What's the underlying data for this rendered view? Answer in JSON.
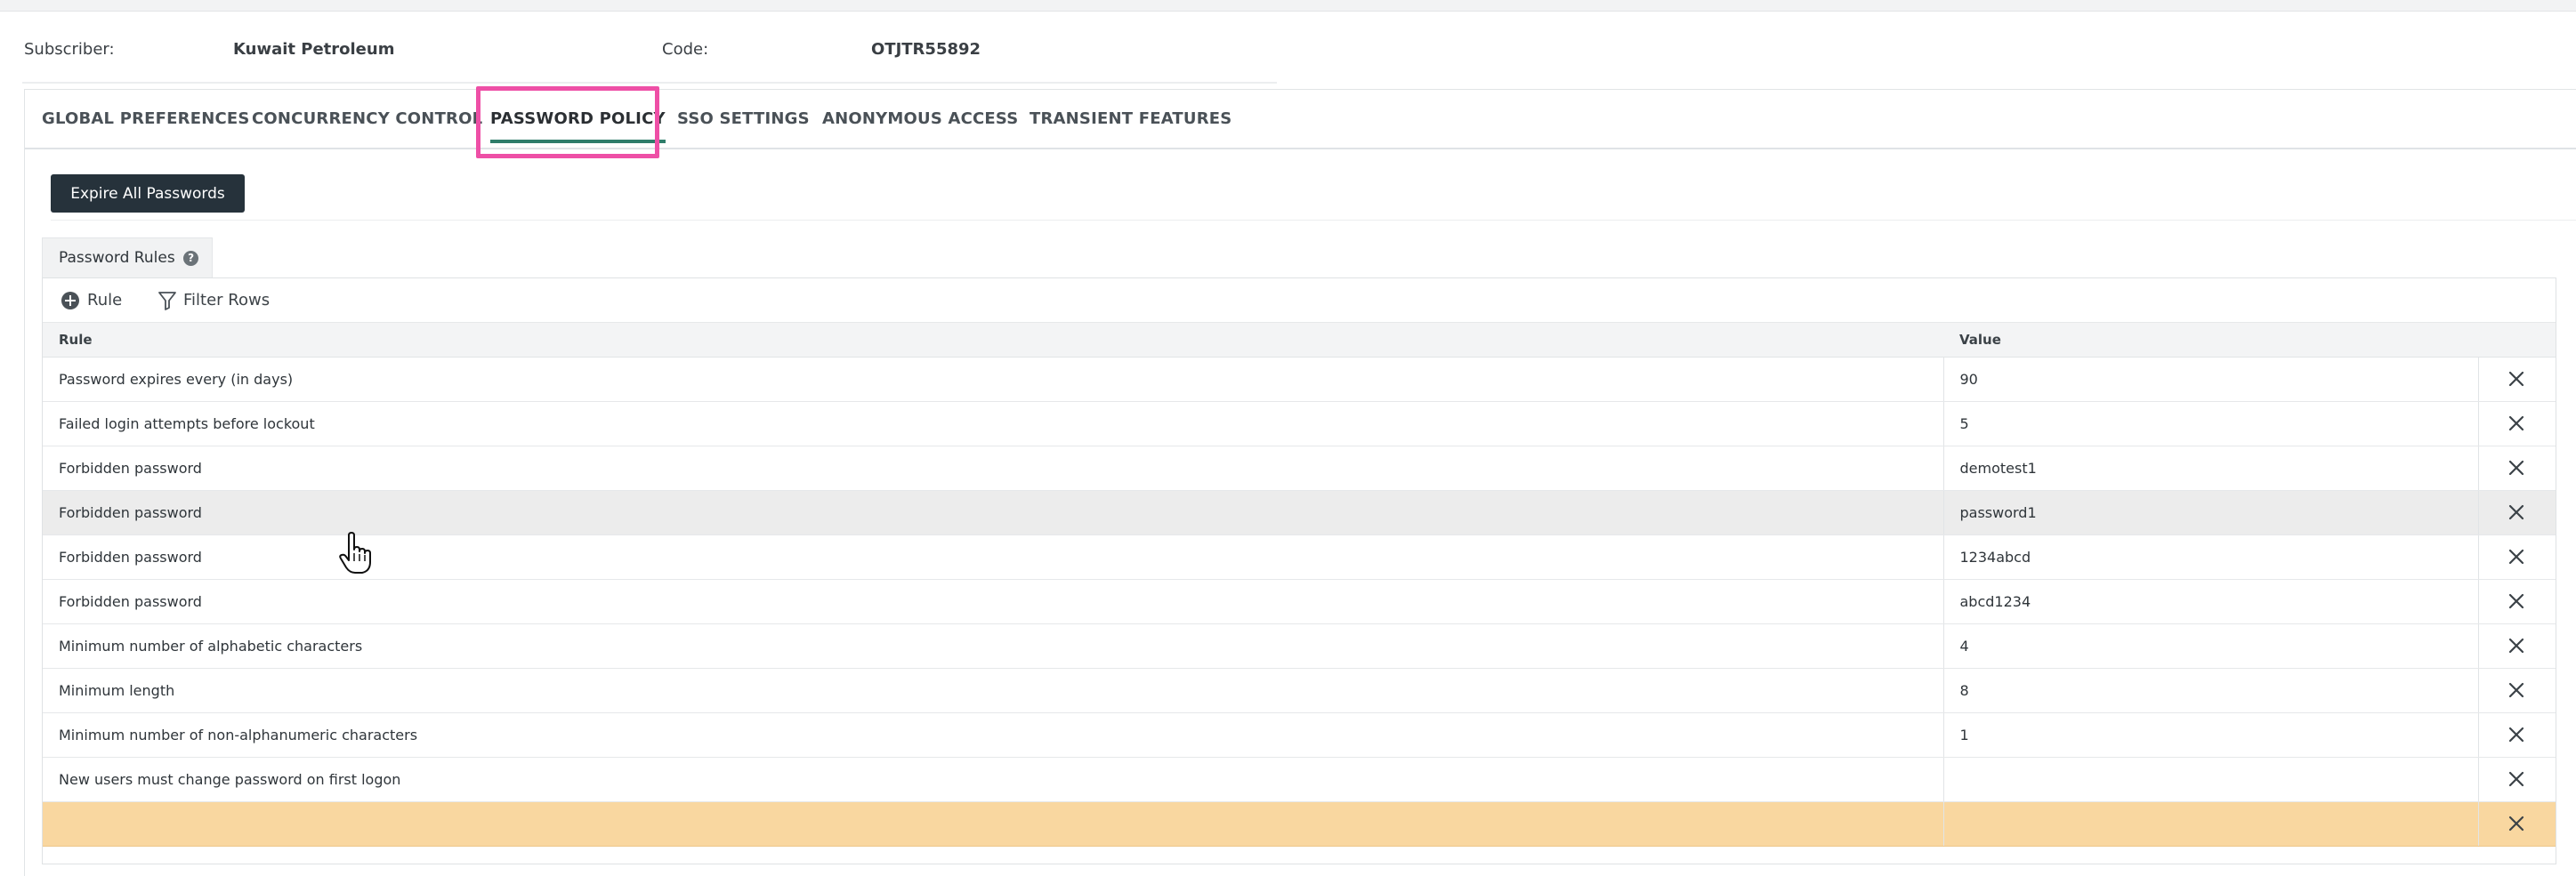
{
  "subscriber": {
    "label": "Subscriber:",
    "value": "Kuwait Petroleum",
    "code_label": "Code:",
    "code_value": "OTJTR55892"
  },
  "tabs": [
    {
      "label": "GLOBAL PREFERENCES",
      "active": false
    },
    {
      "label": "CONCURRENCY CONTROL",
      "active": false
    },
    {
      "label": "PASSWORD POLICY",
      "active": true
    },
    {
      "label": "SSO SETTINGS",
      "active": false
    },
    {
      "label": "ANONYMOUS ACCESS",
      "active": false
    },
    {
      "label": "TRANSIENT FEATURES",
      "active": false
    }
  ],
  "actions": {
    "expire_all": "Expire All Passwords"
  },
  "rules_panel": {
    "title": "Password Rules",
    "help_icon": "?",
    "toolbar": {
      "add_rule": "Rule",
      "filter_rows": "Filter Rows"
    },
    "columns": {
      "rule": "Rule",
      "value": "Value"
    },
    "rows": [
      {
        "rule": "Password expires every (in days)",
        "value": "90"
      },
      {
        "rule": "Failed login attempts before lockout",
        "value": "5"
      },
      {
        "rule": "Forbidden password",
        "value": "demotest1"
      },
      {
        "rule": "Forbidden password",
        "value": "password1"
      },
      {
        "rule": "Forbidden password",
        "value": "1234abcd"
      },
      {
        "rule": "Forbidden password",
        "value": "abcd1234"
      },
      {
        "rule": "Minimum number of alphabetic characters",
        "value": "4"
      },
      {
        "rule": "Minimum length",
        "value": "8"
      },
      {
        "rule": "Minimum number of non-alphanumeric characters",
        "value": "1"
      },
      {
        "rule": "New users must change password on first logon",
        "value": ""
      },
      {
        "rule": "",
        "value": ""
      }
    ]
  },
  "colors": {
    "accent": "#2f7d6a",
    "highlight_box": "#ee4fa6",
    "button_bg": "#26323b",
    "new_row": "#f9d7a0",
    "hover_row": "#ececec"
  },
  "icons": {
    "add": "plus-circle-icon",
    "filter": "filter-icon",
    "delete": "close-icon",
    "help": "question-circle-icon",
    "cursor": "hand-pointer-icon"
  }
}
